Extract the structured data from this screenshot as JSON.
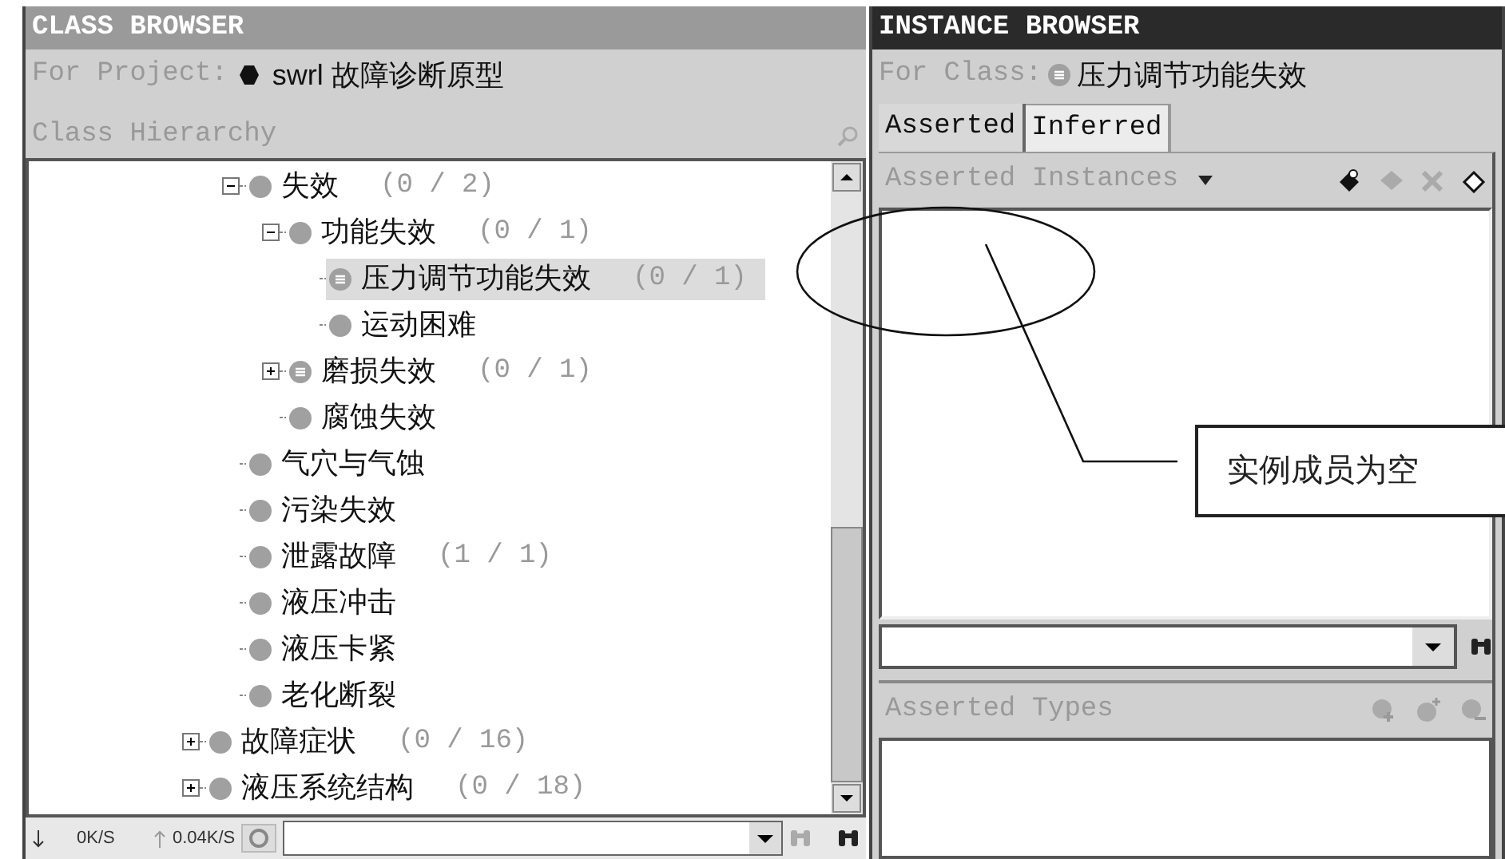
{
  "class_browser": {
    "title": "CLASS BROWSER",
    "project_label": "For Project:",
    "project_name": "swrl 故障诊断原型",
    "hierarchy_label": "Class Hierarchy",
    "tree": {
      "open_branch": [
        {
          "label": "失效",
          "count": "(0 / 2)",
          "kind": "plain",
          "expanded": true,
          "selected": false,
          "children": [
            {
              "label": "功能失效",
              "count": "(0 / 1)",
              "kind": "plain",
              "expanded": true,
              "selected": false,
              "children": [
                {
                  "label": "压力调节功能失效",
                  "count": "(0 / 1)",
                  "kind": "defined",
                  "selected": true
                },
                {
                  "label": "运动困难",
                  "kind": "plain",
                  "selected": false
                }
              ]
            },
            {
              "label": "磨损失效",
              "count": "(0 / 1)",
              "kind": "defined",
              "expanded": false,
              "selected": false
            },
            {
              "label": "腐蚀失效",
              "kind": "plain",
              "selected": false
            }
          ]
        },
        {
          "label": "气穴与气蚀",
          "kind": "plain",
          "selected": false
        },
        {
          "label": "污染失效",
          "kind": "plain",
          "selected": false
        },
        {
          "label": "泄露故障",
          "count": "(1 / 1)",
          "kind": "plain",
          "selected": false
        },
        {
          "label": "液压冲击",
          "kind": "plain",
          "selected": false
        },
        {
          "label": "液压卡紧",
          "kind": "plain",
          "selected": false
        },
        {
          "label": "老化断裂",
          "kind": "plain",
          "selected": false
        }
      ],
      "items": [
        {
          "label": "故障症状",
          "count": "(0 / 16)",
          "kind": "plain",
          "expanded": false,
          "selected": false
        },
        {
          "label": "液压系统结构",
          "count": "(0 / 18)",
          "kind": "plain",
          "expanded": false,
          "selected": false
        }
      ]
    },
    "status": {
      "down": "0K/S",
      "up": "0.04K/S"
    }
  },
  "instance_browser": {
    "title": "INSTANCE BROWSER",
    "class_label": "For Class:",
    "class_name": "压力调节功能失效",
    "tabs": [
      {
        "label": "Asserted",
        "selected": true
      },
      {
        "label": "Inferred",
        "selected": false
      }
    ],
    "instances_label": "Asserted Instances",
    "types_label": "Asserted Types"
  },
  "annotation": {
    "text": "实例成员为空"
  }
}
